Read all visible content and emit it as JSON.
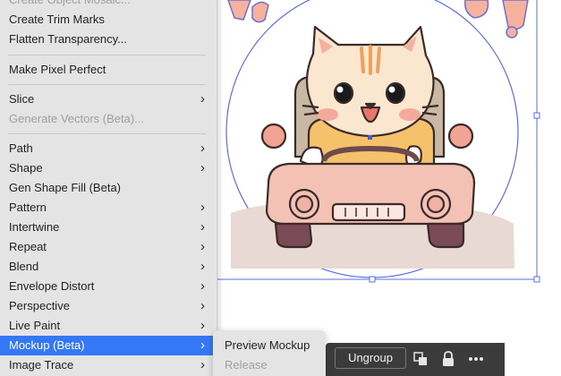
{
  "colors": {
    "menu_bg": "#e4e4e4",
    "highlight": "#3478f6",
    "disabled_text": "#9e9e9e",
    "selection_blue": "#5b6ee8",
    "taskbar_bg": "#3b3b3b"
  },
  "object_menu": {
    "items": [
      {
        "label": "Create Object Mosaic...",
        "disabled": true
      },
      {
        "label": "Create Trim Marks"
      },
      {
        "label": "Flatten Transparency..."
      },
      {
        "label": "Make Pixel Perfect"
      },
      {
        "label": "Slice",
        "submenu": true
      },
      {
        "label": "Generate Vectors (Beta)...",
        "disabled": true
      },
      {
        "label": "Path",
        "submenu": true
      },
      {
        "label": "Shape",
        "submenu": true
      },
      {
        "label": "Gen Shape Fill (Beta)"
      },
      {
        "label": "Pattern",
        "submenu": true
      },
      {
        "label": "Intertwine",
        "submenu": true
      },
      {
        "label": "Repeat",
        "submenu": true
      },
      {
        "label": "Blend",
        "submenu": true
      },
      {
        "label": "Envelope Distort",
        "submenu": true
      },
      {
        "label": "Perspective",
        "submenu": true
      },
      {
        "label": "Live Paint",
        "submenu": true
      },
      {
        "label": "Mockup (Beta)",
        "submenu": true,
        "highlighted": true
      },
      {
        "label": "Image Trace",
        "submenu": true
      }
    ],
    "chevron": "›"
  },
  "submenu": {
    "items": [
      {
        "label": "Preview Mockup"
      },
      {
        "label": "Release",
        "disabled": true
      }
    ]
  },
  "taskbar": {
    "ungroup_label": "Ungroup",
    "icons": [
      "arrange-icon",
      "lock-icon",
      "more-options-icon"
    ]
  }
}
